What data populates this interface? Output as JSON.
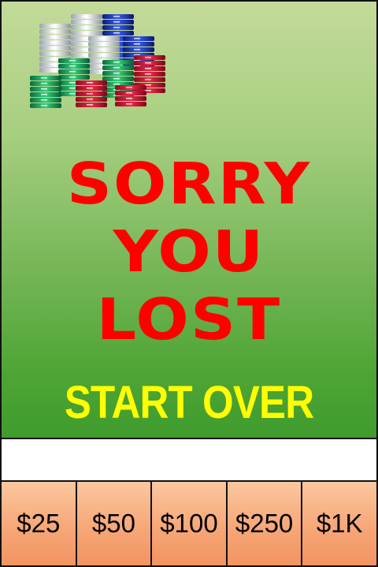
{
  "message": {
    "line1": "SORRY",
    "line2": "YOU",
    "line3": "LOST"
  },
  "action": {
    "start_over": "START OVER"
  },
  "bets": [
    "$25",
    "$50",
    "$100",
    "$250",
    "$1K"
  ],
  "colors": {
    "felt": "#4ea535",
    "headline": "#ff0000",
    "start_over": "#ffff00",
    "bet_button": "#f7a778"
  },
  "icons": {
    "chips": "poker-chip-stacks"
  }
}
